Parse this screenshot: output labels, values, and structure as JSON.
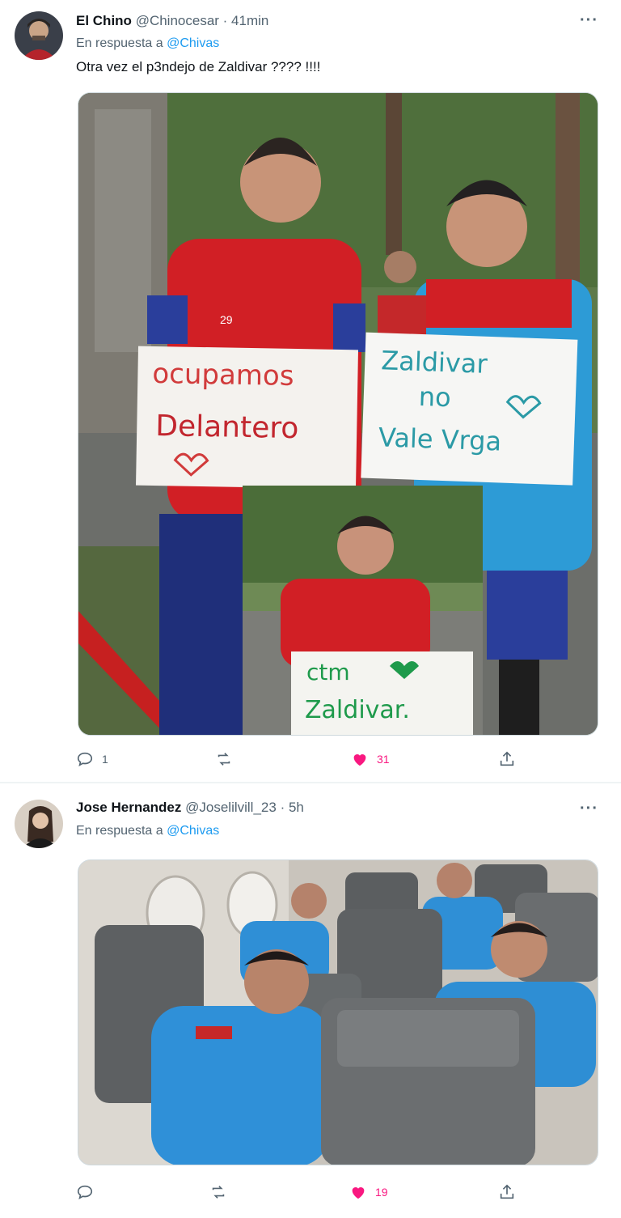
{
  "tweets": [
    {
      "name": "El Chino",
      "handle": "@Chinocesar",
      "time": "· 41min",
      "reply_prefix": "En respuesta a",
      "reply_to": "@Chivas",
      "text": "Otra vez el p3ndejo de Zaldivar ???? !!!!",
      "media_signs": {
        "sign1_line1": "ocupamos",
        "sign1_line2": "Delantero",
        "sign2_line1": "Zaldivar",
        "sign2_line2": "no",
        "sign2_line3": "Vale Vrga",
        "sign3_line1": "ctm",
        "sign3_line2": "Zaldivar."
      },
      "jersey_number": "29",
      "actions": {
        "replies": "1",
        "retweets": "",
        "likes": "31"
      }
    },
    {
      "name": "Jose Hernandez",
      "handle": "@Joselilvill_23",
      "time": "· 5h",
      "reply_prefix": "En respuesta a",
      "reply_to": "@Chivas",
      "text": "",
      "actions": {
        "replies": "",
        "retweets": "",
        "likes": "19"
      }
    }
  ],
  "more_icon": "more-dots-icon",
  "colors": {
    "accent": "#1d9bf0",
    "like": "#f91880",
    "muted": "#536471"
  }
}
